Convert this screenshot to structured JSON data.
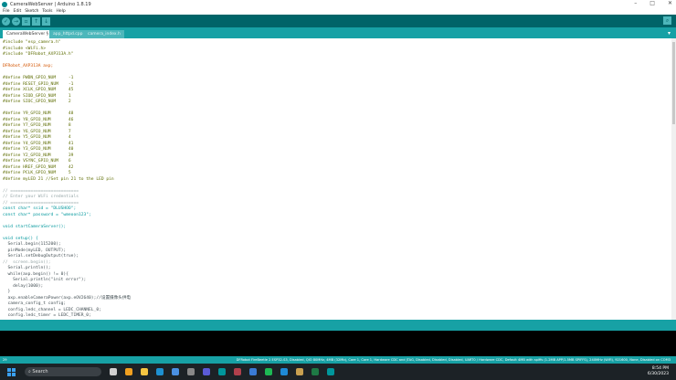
{
  "window": {
    "title": "CameraWebServer | Arduino 1.8.19",
    "controls": [
      "–",
      "□",
      "✕"
    ]
  },
  "menu": [
    "File",
    "Edit",
    "Sketch",
    "Tools",
    "Help"
  ],
  "toolbar": {
    "verify": "✓",
    "upload": "→",
    "new": "▫",
    "open": "↑",
    "save": "↓",
    "serial_monitor": "⌕"
  },
  "tabs": [
    {
      "label": "CameraWebServer §",
      "active": true
    },
    {
      "label": "app_httpd.cpp",
      "active": false
    },
    {
      "label": "camera_index.h",
      "active": false
    }
  ],
  "tab_menu": "▾",
  "editor": {
    "lines": [
      "#include \"esp_camera.h\"",
      "#include <WiFi.h>",
      "#include \"DFRobot_AXP313A.h\"",
      "",
      "DFRobot_AXP313A axp;",
      "",
      "#define PWDN_GPIO_NUM     -1",
      "#define RESET_GPIO_NUM    -1",
      "#define XCLK_GPIO_NUM     45",
      "#define SIOD_GPIO_NUM     1",
      "#define SIOC_GPIO_NUM     2",
      "",
      "#define Y9_GPIO_NUM       48",
      "#define Y8_GPIO_NUM       46",
      "#define Y7_GPIO_NUM       8",
      "#define Y6_GPIO_NUM       7",
      "#define Y5_GPIO_NUM       4",
      "#define Y4_GPIO_NUM       41",
      "#define Y3_GPIO_NUM       40",
      "#define Y2_GPIO_NUM       39",
      "#define VSYNC_GPIO_NUM    6",
      "#define HREF_GPIO_NUM     42",
      "#define PCLK_GPIO_NUM     5",
      "#define myLED 21 //Set pin 21 to the LED pin",
      "",
      "// ===========================",
      "// Enter your WiFi credentials",
      "// ===========================",
      "const char* ssid = \"DLUSHOO\";",
      "const char* password = \"wmeoon123\";",
      "",
      "void startCameraServer();",
      "",
      "void setup() {",
      "  Serial.begin(115200);",
      "  pinMode(myLED, OUTPUT);",
      "  Serial.setDebugOutput(true);",
      "//  screen.begin();",
      "  Serial.println();",
      "  while(axp.begin() != 0){",
      "    Serial.println(\"init error\");",
      "    delay(1000);",
      "  }",
      "  axp.enableCameraPower(axp.eOV2640);//设置摄像头供电",
      "  camera_config_t config;",
      "  config.ledc_channel = LEDC_CHANNEL_0;",
      "  config.ledc_timer = LEDC_TIMER_0;"
    ]
  },
  "status": {
    "line": "29",
    "board": "DFRobot FireBeetle 2 ESP32-S3, Disabled, QIO 80MHz, 4MB (32Mb), Core 1, Core 1, Hardware CDC and JTAG, Disabled, Disabled, Disabled, UART0 / Hardware CDC, Default 4MB with spiffs (1.2MB APP/1.5MB SPIFFS), 240MHz (WiFi), 921600, None, Disabled on COM3"
  },
  "taskbar": {
    "search_placeholder": "Search",
    "time": "8:54 PM",
    "date": "6/30/2023",
    "apps": [
      {
        "name": "task-view",
        "color": "#d0d0d0"
      },
      {
        "name": "widgets",
        "color": "#f0a020"
      },
      {
        "name": "file-explorer",
        "color": "#f5c542"
      },
      {
        "name": "edge",
        "color": "#1e90d0"
      },
      {
        "name": "store",
        "color": "#4a90e2"
      },
      {
        "name": "settings",
        "color": "#888888"
      },
      {
        "name": "visual-studio",
        "color": "#5b5bd6"
      },
      {
        "name": "arduino",
        "color": "#00979c"
      },
      {
        "name": "snipping",
        "color": "#b0404c"
      },
      {
        "name": "app",
        "color": "#3a7bd5"
      },
      {
        "name": "spotify",
        "color": "#1db954"
      },
      {
        "name": "vscode",
        "color": "#1e8ad6"
      },
      {
        "name": "app2",
        "color": "#c8a050"
      },
      {
        "name": "excel",
        "color": "#1e7a45"
      },
      {
        "name": "arduino2",
        "color": "#00979c"
      }
    ]
  }
}
